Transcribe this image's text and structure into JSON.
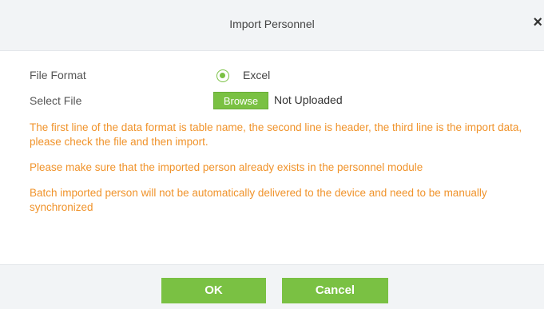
{
  "dialog": {
    "title": "Import Personnel",
    "close_icon": "×"
  },
  "form": {
    "file_format_label": "File Format",
    "file_format_option": "Excel",
    "file_format_selected": true,
    "select_file_label": "Select File",
    "browse_label": "Browse",
    "upload_status": "Not Uploaded"
  },
  "notes": [
    "The first line of the data format is table name, the second line is header, the third line is the import data, please check the file and then import.",
    "Please make sure that the imported person already exists in the personnel module",
    "Batch imported person will not be automatically delivered to the device and need to be manually synchronized"
  ],
  "footer": {
    "ok_label": "OK",
    "cancel_label": "Cancel"
  },
  "colors": {
    "accent": "#7ac143",
    "warning_text": "#f0932b",
    "titlebar_bg": "#f2f4f6"
  }
}
